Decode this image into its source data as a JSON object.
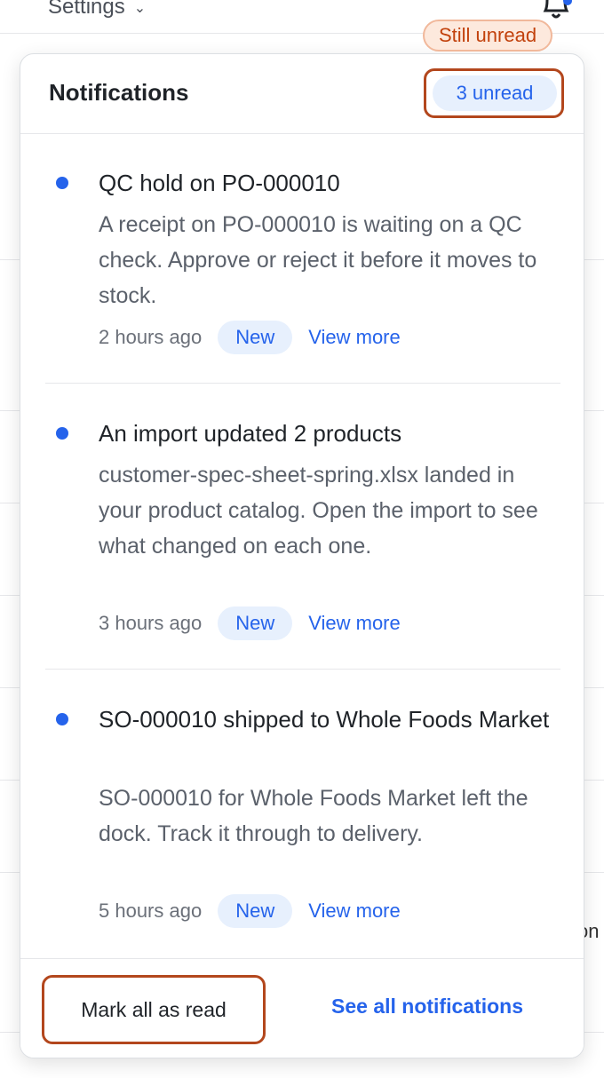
{
  "topbar": {
    "settings_label": "Settings",
    "bell_icon": "bell-icon",
    "clipped_text": "on"
  },
  "tag": {
    "still_unread": "Still unread"
  },
  "notifications": {
    "title": "Notifications",
    "unread_count": "3 unread",
    "items": [
      {
        "title": "QC hold on PO-000010",
        "body": "A receipt on PO-000010 is waiting on a QC check. Approve or reject it before it moves to stock.",
        "time": "2 hours ago",
        "badge": "New",
        "link": "View more"
      },
      {
        "title": "An import updated 2 products",
        "body": "customer-spec-sheet-spring.xlsx landed in your product catalog. Open the import to see what changed on each one.",
        "time": "3 hours ago",
        "badge": "New",
        "link": "View more"
      },
      {
        "title": "SO-000010 shipped to Whole Foods Market",
        "body": "SO-000010 for Whole Foods Market left the dock. Track it through to delivery.",
        "time": "5 hours ago",
        "badge": "New",
        "link": "View more"
      }
    ],
    "footer": {
      "mark_all": "Mark all as read",
      "see_all": "See all notifications"
    }
  },
  "colors": {
    "accent": "#2563eb",
    "highlight_outline": "#b3471d",
    "tag_bg": "#fde9dd",
    "tag_text": "#c2410c"
  }
}
